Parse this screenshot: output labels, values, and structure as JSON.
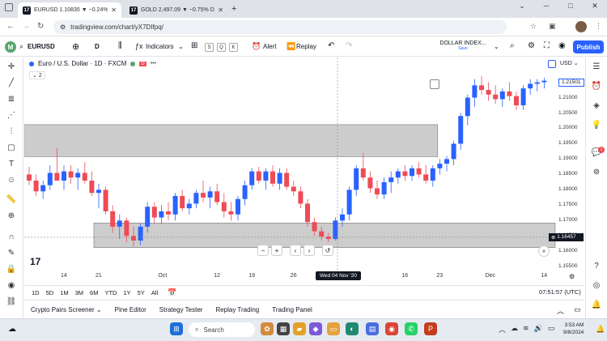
{
  "browser": {
    "tabs": [
      {
        "title": "EURUSD 1.10835 ▼ −0.24% DX",
        "active": true
      },
      {
        "title": "GOLD 2,497.09 ▼ −0.75% DOLLA",
        "active": false
      }
    ],
    "url": "tradingview.com/chart/yX7DIfpq/"
  },
  "toolbar": {
    "profile_initial": "M",
    "symbol": "EURUSD",
    "interval": "D",
    "indicators_label": "Indicators",
    "layout_letters": [
      "S",
      "Q",
      "K"
    ],
    "alert_label": "Alert",
    "replay_label": "Replay",
    "dollar_index_label": "DOLLAR INDEX...",
    "save_label": "Save",
    "publish_label": "Publish"
  },
  "legend": {
    "title": "Euro / U.S. Dollar · 1D · FXCM",
    "indicator_count": "2",
    "currency": "USD"
  },
  "price_axis": {
    "labels": [
      "1.21000",
      "1.20500",
      "1.20000",
      "1.19500",
      "1.19000",
      "1.18500",
      "1.18000",
      "1.17500",
      "1.17000",
      "1.16500",
      "1.16000",
      "1.15500"
    ],
    "badge_top": "1.21501",
    "badge_current": "1.16457"
  },
  "time_axis": {
    "labels": [
      "14",
      "21",
      "Oct",
      "12",
      "19",
      "26",
      "16",
      "23",
      "Dec",
      "14"
    ],
    "selected_label": "Wed 04 Nov '20"
  },
  "chart_nav": [
    "−",
    "+",
    "‹",
    "›",
    "↺"
  ],
  "ranges": [
    "1D",
    "5D",
    "1M",
    "3M",
    "6M",
    "YTD",
    "1Y",
    "5Y",
    "All"
  ],
  "clock_label": "07:51:57 (UTC)",
  "panel_tabs": [
    "Crypto Pairs Screener",
    "Pine Editor",
    "Strategy Tester",
    "Replay Trading",
    "Trading Panel"
  ],
  "alert_count": "1",
  "taskbar": {
    "search_label": "Search",
    "time": "3:53 AM",
    "date": "9/8/2024"
  },
  "colors": {
    "up": "#2962ff",
    "down": "#ef4b56",
    "zone": "#c4c4c4",
    "brand": "#2962ff"
  },
  "chart_data": {
    "type": "candlestick",
    "symbol": "EURUSD",
    "title": "Euro / U.S. Dollar · 1D · FXCM",
    "ylim": [
      1.154,
      1.222
    ],
    "zones": [
      {
        "from": 0,
        "to": 58,
        "low": 1.1908,
        "high": 1.2012
      },
      {
        "from": 10,
        "to": 85,
        "low": 1.1612,
        "high": 1.1692
      }
    ],
    "candles": [
      {
        "o": 1.185,
        "h": 1.1875,
        "l": 1.1815,
        "c": 1.183
      },
      {
        "o": 1.183,
        "h": 1.185,
        "l": 1.178,
        "c": 1.1795
      },
      {
        "o": 1.1795,
        "h": 1.183,
        "l": 1.177,
        "c": 1.1815
      },
      {
        "o": 1.1815,
        "h": 1.188,
        "l": 1.18,
        "c": 1.1855
      },
      {
        "o": 1.1855,
        "h": 1.1935,
        "l": 1.1835,
        "c": 1.183
      },
      {
        "o": 1.183,
        "h": 1.188,
        "l": 1.18,
        "c": 1.186
      },
      {
        "o": 1.186,
        "h": 1.188,
        "l": 1.182,
        "c": 1.184
      },
      {
        "o": 1.184,
        "h": 1.187,
        "l": 1.18,
        "c": 1.1855
      },
      {
        "o": 1.1855,
        "h": 1.189,
        "l": 1.182,
        "c": 1.183
      },
      {
        "o": 1.183,
        "h": 1.186,
        "l": 1.178,
        "c": 1.179
      },
      {
        "o": 1.179,
        "h": 1.182,
        "l": 1.174,
        "c": 1.18
      },
      {
        "o": 1.18,
        "h": 1.181,
        "l": 1.172,
        "c": 1.173
      },
      {
        "o": 1.173,
        "h": 1.175,
        "l": 1.166,
        "c": 1.168
      },
      {
        "o": 1.168,
        "h": 1.172,
        "l": 1.164,
        "c": 1.17
      },
      {
        "o": 1.17,
        "h": 1.171,
        "l": 1.163,
        "c": 1.165
      },
      {
        "o": 1.165,
        "h": 1.168,
        "l": 1.1615,
        "c": 1.1635
      },
      {
        "o": 1.1635,
        "h": 1.169,
        "l": 1.162,
        "c": 1.168
      },
      {
        "o": 1.168,
        "h": 1.176,
        "l": 1.166,
        "c": 1.1745
      },
      {
        "o": 1.1745,
        "h": 1.176,
        "l": 1.169,
        "c": 1.171
      },
      {
        "o": 1.171,
        "h": 1.175,
        "l": 1.169,
        "c": 1.173
      },
      {
        "o": 1.173,
        "h": 1.176,
        "l": 1.17,
        "c": 1.172
      },
      {
        "o": 1.172,
        "h": 1.179,
        "l": 1.17,
        "c": 1.178
      },
      {
        "o": 1.178,
        "h": 1.18,
        "l": 1.173,
        "c": 1.174
      },
      {
        "o": 1.174,
        "h": 1.177,
        "l": 1.172,
        "c": 1.1755
      },
      {
        "o": 1.1755,
        "h": 1.18,
        "l": 1.174,
        "c": 1.179
      },
      {
        "o": 1.179,
        "h": 1.183,
        "l": 1.176,
        "c": 1.1775
      },
      {
        "o": 1.1775,
        "h": 1.181,
        "l": 1.174,
        "c": 1.1795
      },
      {
        "o": 1.1795,
        "h": 1.182,
        "l": 1.175,
        "c": 1.176
      },
      {
        "o": 1.176,
        "h": 1.179,
        "l": 1.171,
        "c": 1.173
      },
      {
        "o": 1.173,
        "h": 1.176,
        "l": 1.17,
        "c": 1.172
      },
      {
        "o": 1.172,
        "h": 1.178,
        "l": 1.17,
        "c": 1.177
      },
      {
        "o": 1.177,
        "h": 1.183,
        "l": 1.175,
        "c": 1.1815
      },
      {
        "o": 1.1815,
        "h": 1.187,
        "l": 1.18,
        "c": 1.186
      },
      {
        "o": 1.186,
        "h": 1.1875,
        "l": 1.182,
        "c": 1.183
      },
      {
        "o": 1.183,
        "h": 1.187,
        "l": 1.18,
        "c": 1.186
      },
      {
        "o": 1.186,
        "h": 1.188,
        "l": 1.181,
        "c": 1.182
      },
      {
        "o": 1.182,
        "h": 1.187,
        "l": 1.18,
        "c": 1.1855
      },
      {
        "o": 1.1855,
        "h": 1.187,
        "l": 1.18,
        "c": 1.181
      },
      {
        "o": 1.181,
        "h": 1.183,
        "l": 1.178,
        "c": 1.1795
      },
      {
        "o": 1.1795,
        "h": 1.181,
        "l": 1.174,
        "c": 1.1755
      },
      {
        "o": 1.1755,
        "h": 1.177,
        "l": 1.168,
        "c": 1.1695
      },
      {
        "o": 1.1695,
        "h": 1.171,
        "l": 1.165,
        "c": 1.1665
      },
      {
        "o": 1.1665,
        "h": 1.168,
        "l": 1.1635,
        "c": 1.1648
      },
      {
        "o": 1.1648,
        "h": 1.166,
        "l": 1.163,
        "c": 1.164
      },
      {
        "o": 1.164,
        "h": 1.171,
        "l": 1.1635,
        "c": 1.17
      },
      {
        "o": 1.17,
        "h": 1.174,
        "l": 1.168,
        "c": 1.172
      },
      {
        "o": 1.172,
        "h": 1.181,
        "l": 1.17,
        "c": 1.18
      },
      {
        "o": 1.18,
        "h": 1.188,
        "l": 1.178,
        "c": 1.187
      },
      {
        "o": 1.187,
        "h": 1.192,
        "l": 1.183,
        "c": 1.184
      },
      {
        "o": 1.184,
        "h": 1.186,
        "l": 1.179,
        "c": 1.1805
      },
      {
        "o": 1.1805,
        "h": 1.183,
        "l": 1.177,
        "c": 1.1785
      },
      {
        "o": 1.1785,
        "h": 1.184,
        "l": 1.177,
        "c": 1.1825
      },
      {
        "o": 1.1825,
        "h": 1.186,
        "l": 1.179,
        "c": 1.184
      },
      {
        "o": 1.184,
        "h": 1.187,
        "l": 1.182,
        "c": 1.186
      },
      {
        "o": 1.186,
        "h": 1.188,
        "l": 1.183,
        "c": 1.1845
      },
      {
        "o": 1.1845,
        "h": 1.188,
        "l": 1.183,
        "c": 1.187
      },
      {
        "o": 1.187,
        "h": 1.189,
        "l": 1.184,
        "c": 1.185
      },
      {
        "o": 1.185,
        "h": 1.188,
        "l": 1.182,
        "c": 1.183
      },
      {
        "o": 1.183,
        "h": 1.188,
        "l": 1.181,
        "c": 1.187
      },
      {
        "o": 1.187,
        "h": 1.19,
        "l": 1.185,
        "c": 1.1885
      },
      {
        "o": 1.1885,
        "h": 1.191,
        "l": 1.186,
        "c": 1.19
      },
      {
        "o": 1.19,
        "h": 1.196,
        "l": 1.188,
        "c": 1.195
      },
      {
        "o": 1.195,
        "h": 1.205,
        "l": 1.193,
        "c": 1.204
      },
      {
        "o": 1.204,
        "h": 1.211,
        "l": 1.201,
        "c": 1.21
      },
      {
        "o": 1.21,
        "h": 1.216,
        "l": 1.207,
        "c": 1.214
      },
      {
        "o": 1.214,
        "h": 1.217,
        "l": 1.211,
        "c": 1.2125
      },
      {
        "o": 1.2125,
        "h": 1.215,
        "l": 1.209,
        "c": 1.211
      },
      {
        "o": 1.211,
        "h": 1.214,
        "l": 1.208,
        "c": 1.2095
      },
      {
        "o": 1.2095,
        "h": 1.213,
        "l": 1.207,
        "c": 1.212
      },
      {
        "o": 1.212,
        "h": 1.215,
        "l": 1.209,
        "c": 1.2105
      },
      {
        "o": 1.2105,
        "h": 1.212,
        "l": 1.206,
        "c": 1.2075
      },
      {
        "o": 1.2075,
        "h": 1.214,
        "l": 1.206,
        "c": 1.213
      },
      {
        "o": 1.213,
        "h": 1.216,
        "l": 1.211,
        "c": 1.2145
      },
      {
        "o": 1.2145,
        "h": 1.216,
        "l": 1.212,
        "c": 1.215
      },
      {
        "o": 1.215,
        "h": 1.2165,
        "l": 1.213,
        "c": 1.2155
      }
    ]
  }
}
